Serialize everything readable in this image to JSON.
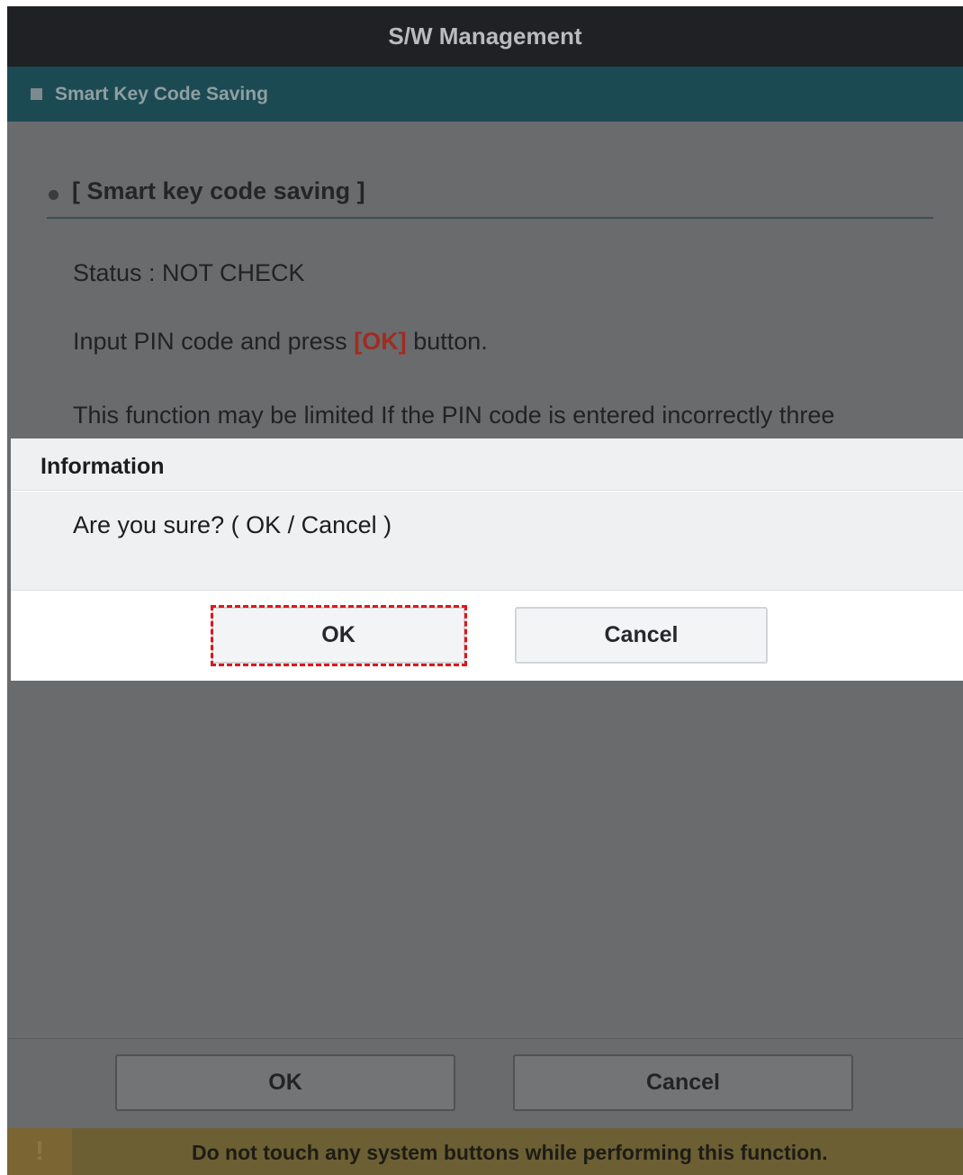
{
  "titlebar": {
    "title": "S/W Management"
  },
  "section": {
    "label": "Smart Key Code Saving"
  },
  "content": {
    "heading": "[ Smart key code saving ]",
    "status": "Status : NOT CHECK",
    "instruction_pre": "Input PIN code and press",
    "instruction_highlight": "[OK]",
    "instruction_post": "button.",
    "warning_line": "This function may be limited If the PIN code is entered incorrectly three"
  },
  "dialog": {
    "title": "Information",
    "message": "Are you sure? ( OK / Cancel )",
    "ok_label": "OK",
    "cancel_label": "Cancel"
  },
  "bottom": {
    "ok_label": "OK",
    "cancel_label": "Cancel"
  },
  "warningbar": {
    "icon_glyph": "!",
    "text": "Do not touch any system buttons while performing this function."
  },
  "colors": {
    "titlebar_bg": "#1f2124",
    "section_bg": "#1c4a52",
    "overlay_bg": "#6a6b6d",
    "highlight_red": "#e0151b",
    "pin_ok_red": "#a02c22",
    "warn_bg": "#6c5f33"
  },
  "icons": {
    "section": "square-icon",
    "heading": "bullet-dot-icon",
    "warning": "exclamation-icon"
  }
}
